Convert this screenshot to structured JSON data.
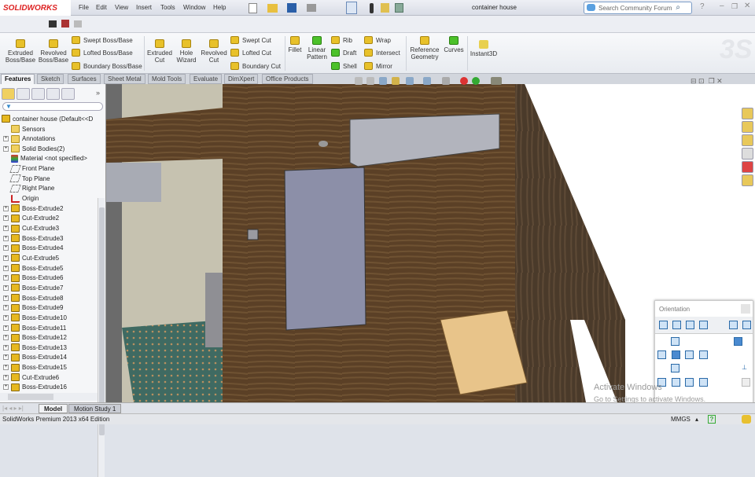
{
  "app": {
    "logo": "SOLIDWORKS",
    "title": "container house",
    "search_placeholder": "Search Community Forum"
  },
  "menu": [
    "File",
    "Edit",
    "View",
    "Insert",
    "Tools",
    "Window",
    "Help"
  ],
  "ribbon": {
    "large": [
      {
        "label1": "Extruded",
        "label2": "Boss/Base"
      },
      {
        "label1": "Revolved",
        "label2": "Boss/Base"
      },
      {
        "label1": "Extruded",
        "label2": "Cut"
      },
      {
        "label1": "Hole",
        "label2": "Wizard"
      },
      {
        "label1": "Revolved",
        "label2": "Cut"
      },
      {
        "label1": "Fillet",
        "label2": ""
      },
      {
        "label1": "Linear",
        "label2": "Pattern"
      },
      {
        "label1": "Reference",
        "label2": "Geometry"
      },
      {
        "label1": "Curves",
        "label2": ""
      },
      {
        "label1": "Instant3D",
        "label2": ""
      }
    ],
    "boss_small": [
      "Swept Boss/Base",
      "Lofted Boss/Base",
      "Boundary Boss/Base"
    ],
    "cut_small": [
      "Swept Cut",
      "Lofted Cut",
      "Boundary Cut"
    ],
    "feat_small": [
      "Rib",
      "Draft",
      "Shell"
    ],
    "feat_small2": [
      "Wrap",
      "Intersect",
      "Mirror"
    ]
  },
  "tabs": [
    "Features",
    "Sketch",
    "Surfaces",
    "Sheet Metal",
    "Mold Tools",
    "Evaluate",
    "DimXpert",
    "Office Products"
  ],
  "tree": {
    "root": "container house  (Default<<D",
    "items": [
      {
        "label": "Sensors",
        "type": "fold",
        "expand": false
      },
      {
        "label": "Annotations",
        "type": "fold",
        "expand": true
      },
      {
        "label": "Solid Bodies(2)",
        "type": "fold",
        "expand": true
      },
      {
        "label": "Material <not specified>",
        "type": "mat",
        "expand": false
      },
      {
        "label": "Front Plane",
        "type": "plane",
        "expand": false
      },
      {
        "label": "Top Plane",
        "type": "plane",
        "expand": false
      },
      {
        "label": "Right Plane",
        "type": "plane",
        "expand": false
      },
      {
        "label": "Origin",
        "type": "origin",
        "expand": false
      },
      {
        "label": "Boss-Extrude2",
        "type": "feat",
        "expand": true
      },
      {
        "label": "Cut-Extrude2",
        "type": "feat",
        "expand": true
      },
      {
        "label": "Cut-Extrude3",
        "type": "feat",
        "expand": true
      },
      {
        "label": "Boss-Extrude3",
        "type": "feat",
        "expand": true
      },
      {
        "label": "Boss-Extrude4",
        "type": "feat",
        "expand": true
      },
      {
        "label": "Cut-Extrude5",
        "type": "feat",
        "expand": true
      },
      {
        "label": "Boss-Extrude5",
        "type": "feat",
        "expand": true
      },
      {
        "label": "Boss-Extrude6",
        "type": "feat",
        "expand": true
      },
      {
        "label": "Boss-Extrude7",
        "type": "feat",
        "expand": true
      },
      {
        "label": "Boss-Extrude8",
        "type": "feat",
        "expand": true
      },
      {
        "label": "Boss-Extrude9",
        "type": "feat",
        "expand": true
      },
      {
        "label": "Boss-Extrude10",
        "type": "feat",
        "expand": true
      },
      {
        "label": "Boss-Extrude11",
        "type": "feat",
        "expand": true
      },
      {
        "label": "Boss-Extrude12",
        "type": "feat",
        "expand": true
      },
      {
        "label": "Boss-Extrude13",
        "type": "feat",
        "expand": true
      },
      {
        "label": "Boss-Extrude14",
        "type": "feat",
        "expand": true
      },
      {
        "label": "Boss-Extrude15",
        "type": "feat",
        "expand": true
      },
      {
        "label": "Cut-Extrude6",
        "type": "feat",
        "expand": true
      },
      {
        "label": "Boss-Extrude16",
        "type": "feat",
        "expand": true
      }
    ]
  },
  "orientation": {
    "title": "Orientation"
  },
  "watermark": {
    "line1": "Activate Windows",
    "line2": "Go to Settings to activate Windows."
  },
  "bottom_tabs": [
    "Model",
    "Motion Study 1"
  ],
  "status": {
    "left": "SolidWorks Premium 2013 x64 Edition",
    "units": "MMGS"
  }
}
